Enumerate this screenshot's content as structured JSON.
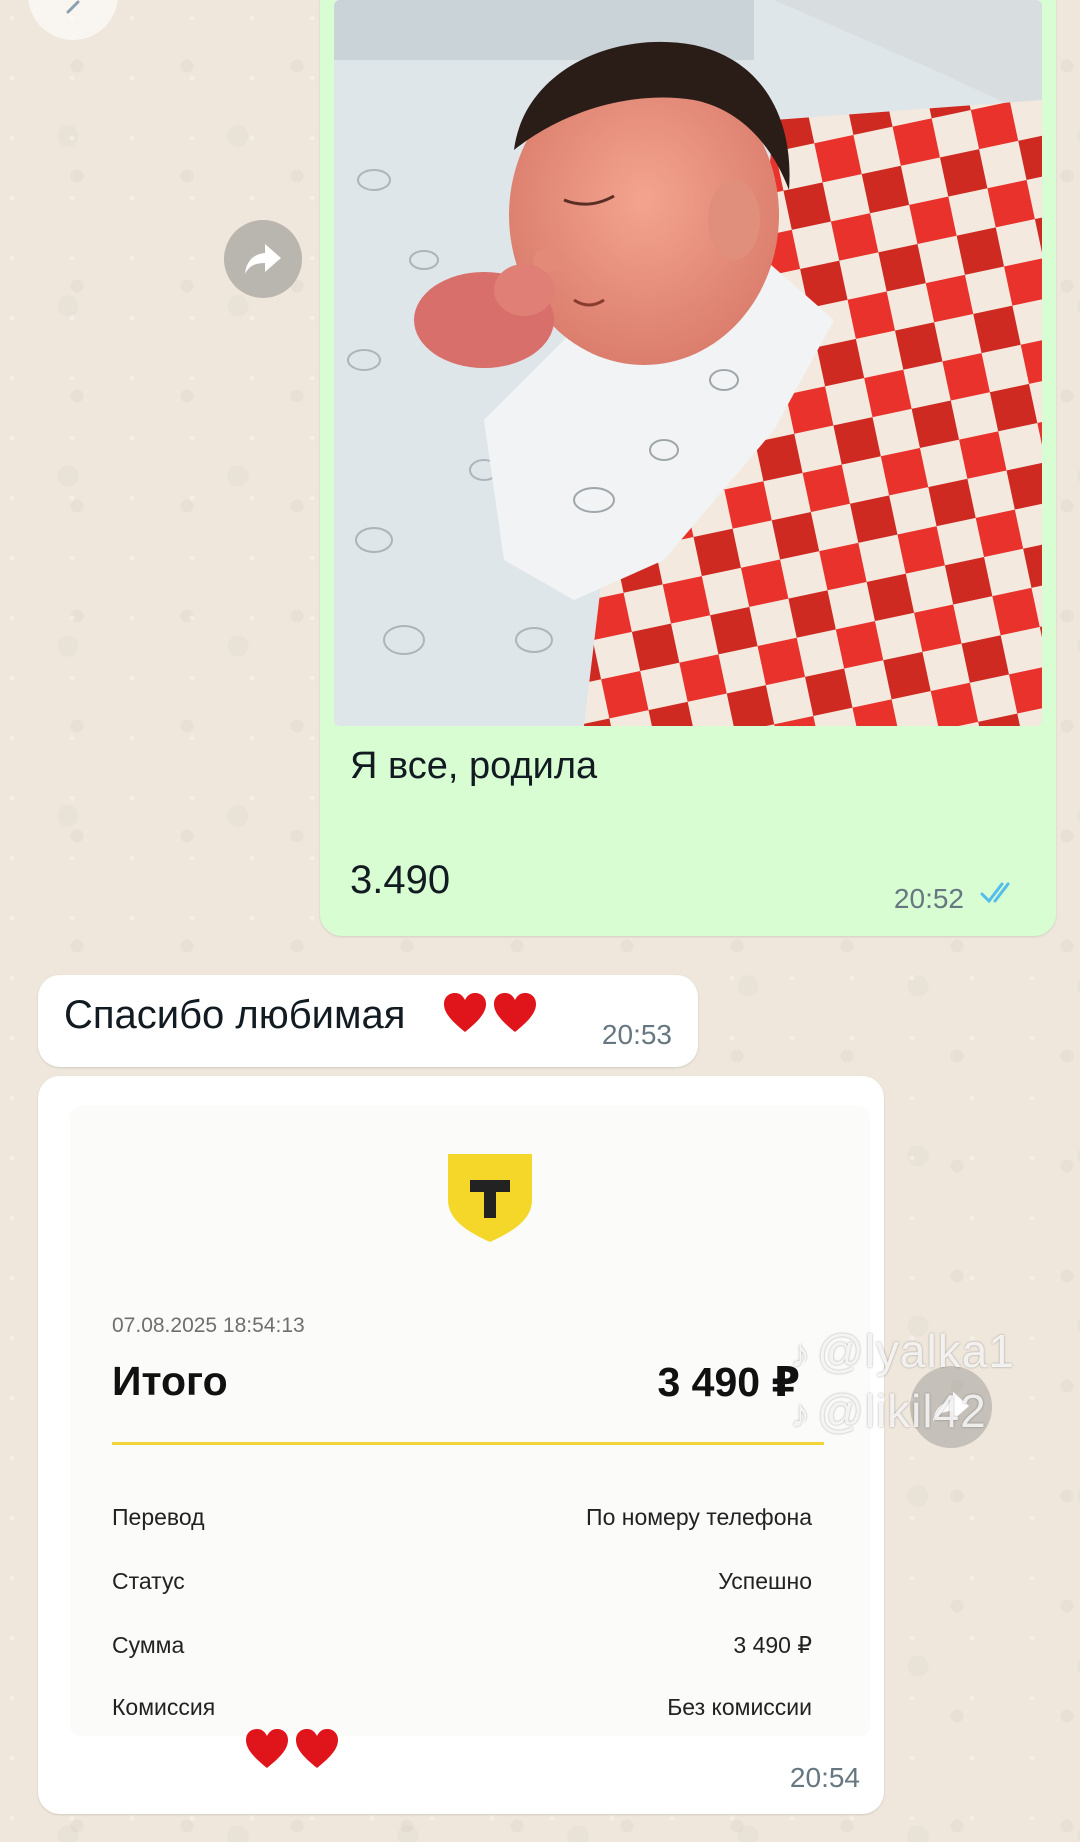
{
  "icons": {
    "back": "chevron-left-icon",
    "forward": "forward-arrow-icon",
    "read_receipt": "double-check-icon",
    "heart": "red-heart-icon",
    "bank_logo": "shield-t-logo",
    "tiktok": "tiktok-note-icon"
  },
  "colors": {
    "outgoing_bubble": "#d9fdd3",
    "incoming_bubble": "#ffffff",
    "read_tick": "#53bdeb",
    "bank_yellow": "#f5d72a",
    "divider": "#f1d33a",
    "heart": "#e0151b"
  },
  "outgoing_message": {
    "caption": "Я все, родила",
    "amount": "3.490",
    "time": "20:52"
  },
  "incoming_message": {
    "text": "Спасибо любимая",
    "time": "20:53"
  },
  "receipt_message": {
    "datetime": "07.08.2025 18:54:13",
    "total_label": "Итого",
    "total_value": "3 490 ₽",
    "rows": [
      {
        "label": "Перевод",
        "value": "По номеру телефона"
      },
      {
        "label": "Статус",
        "value": "Успешно"
      },
      {
        "label": "Сумма",
        "value": "3 490 ₽"
      },
      {
        "label": "Комиссия",
        "value": "Без комиссии"
      }
    ],
    "time": "20:54"
  },
  "watermark": {
    "handle1": "@lyalka1",
    "handle2": "@likil42"
  }
}
